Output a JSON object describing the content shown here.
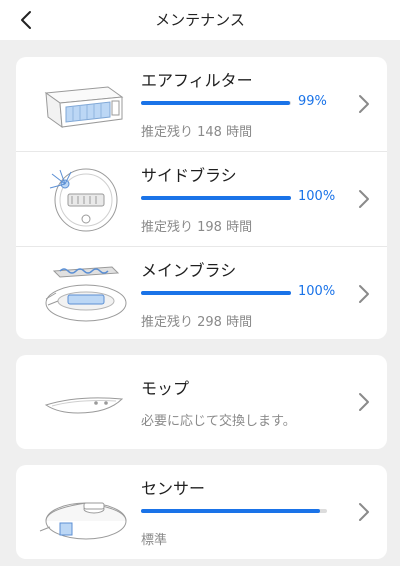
{
  "header": {
    "title": "メンテナンス"
  },
  "items": [
    {
      "title": "エアフィルター",
      "progress_pct": 99,
      "percent_label": "99%",
      "subtitle": "推定残り 148 時間"
    },
    {
      "title": "サイドブラシ",
      "progress_pct": 100,
      "percent_label": "100%",
      "subtitle": "推定残り 198 時間"
    },
    {
      "title": "メインブラシ",
      "progress_pct": 100,
      "percent_label": "100%",
      "subtitle": "推定残り 298 時間"
    },
    {
      "title": "モップ",
      "subtitle": "必要に応じて交換します。"
    },
    {
      "title": "センサー",
      "progress_pct": 96,
      "subtitle": "標準"
    }
  ],
  "icons": {
    "back": "chevron-left-icon",
    "row_arrow": "chevron-right-icon"
  },
  "colors": {
    "accent": "#1a73e8",
    "background": "#efefef",
    "card": "#ffffff",
    "track": "#dcdcdc",
    "subtext": "#8a8a8a"
  }
}
